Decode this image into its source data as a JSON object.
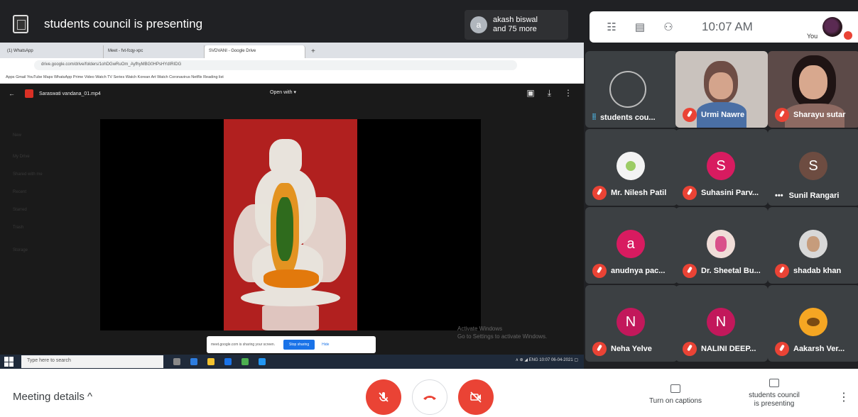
{
  "presenter": {
    "title": "students council is presenting",
    "viewers_initial": "a",
    "viewers_line1": "akash biswal",
    "viewers_line2": "and 75 more"
  },
  "chrome": {
    "tabs": [
      "(1) WhatsApp",
      "Meet - fvt-fcqy-xpc",
      "SVDVANI - Google Drive"
    ],
    "new_tab": "+",
    "url": "drive.google.com/drive/folders/1ohDGwRuOm_AyfhyMBG0HPsHYdIRIDG",
    "bookmarks": "Apps   Gmail   YouTube   Maps   WhatsApp   Prime Video   Watch TV Series   Watch Korean Art   Watch Coronavirus   Netflix        Reading list"
  },
  "drive": {
    "file_name": "Saraswati vandana_01.mp4",
    "open_with": "Open with ▾",
    "side_items": [
      "New",
      "My Drive",
      "Shared with me",
      "Recent",
      "Starred",
      "Trash",
      "Storage"
    ],
    "activate_line1": "Activate Windows",
    "activate_line2": "Go to Settings to activate Windows.",
    "share_text": "meet.google.com is sharing your screen.",
    "stop_sharing": "Stop sharing",
    "hide": "Hide"
  },
  "taskbar": {
    "search_placeholder": "Type here to search",
    "tray": "∧  ⊕  ◢  ENG   10:07  06-04-2021   ▢"
  },
  "top": {
    "time": "10:07 AM",
    "self_label": "You"
  },
  "participants": [
    {
      "name": "students cou...",
      "type": "logo",
      "speaking": true
    },
    {
      "name": "Urmi Nawre",
      "type": "video"
    },
    {
      "name": "Sharayu sutar",
      "type": "video"
    },
    {
      "name": "Mr. Nilesh Patil",
      "type": "photo",
      "color": "#f3f3f3"
    },
    {
      "name": "Suhasini Parv...",
      "initial": "S",
      "color": "#d81b60"
    },
    {
      "name": "Sunil Rangari",
      "initial": "S",
      "color": "#6d4c41",
      "more": true
    },
    {
      "name": "anudnya pac...",
      "initial": "a",
      "color": "#d81b60"
    },
    {
      "name": "Dr. Sheetal Bu...",
      "type": "photo",
      "color": "#f0ddd8"
    },
    {
      "name": "shadab khan",
      "type": "photo",
      "color": "#d8d8d8"
    },
    {
      "name": "Neha Yelve",
      "initial": "N",
      "color": "#c2185b"
    },
    {
      "name": "NALINI DEEP...",
      "initial": "N",
      "color": "#c2185b"
    },
    {
      "name": "Aakarsh Ver...",
      "type": "photo",
      "color": "#f5a623"
    }
  ],
  "bottom": {
    "meeting_details": "Meeting details  ^",
    "captions": "Turn on captions",
    "present_line1": "students council",
    "present_line2": "is presenting",
    "more": "⋮"
  }
}
